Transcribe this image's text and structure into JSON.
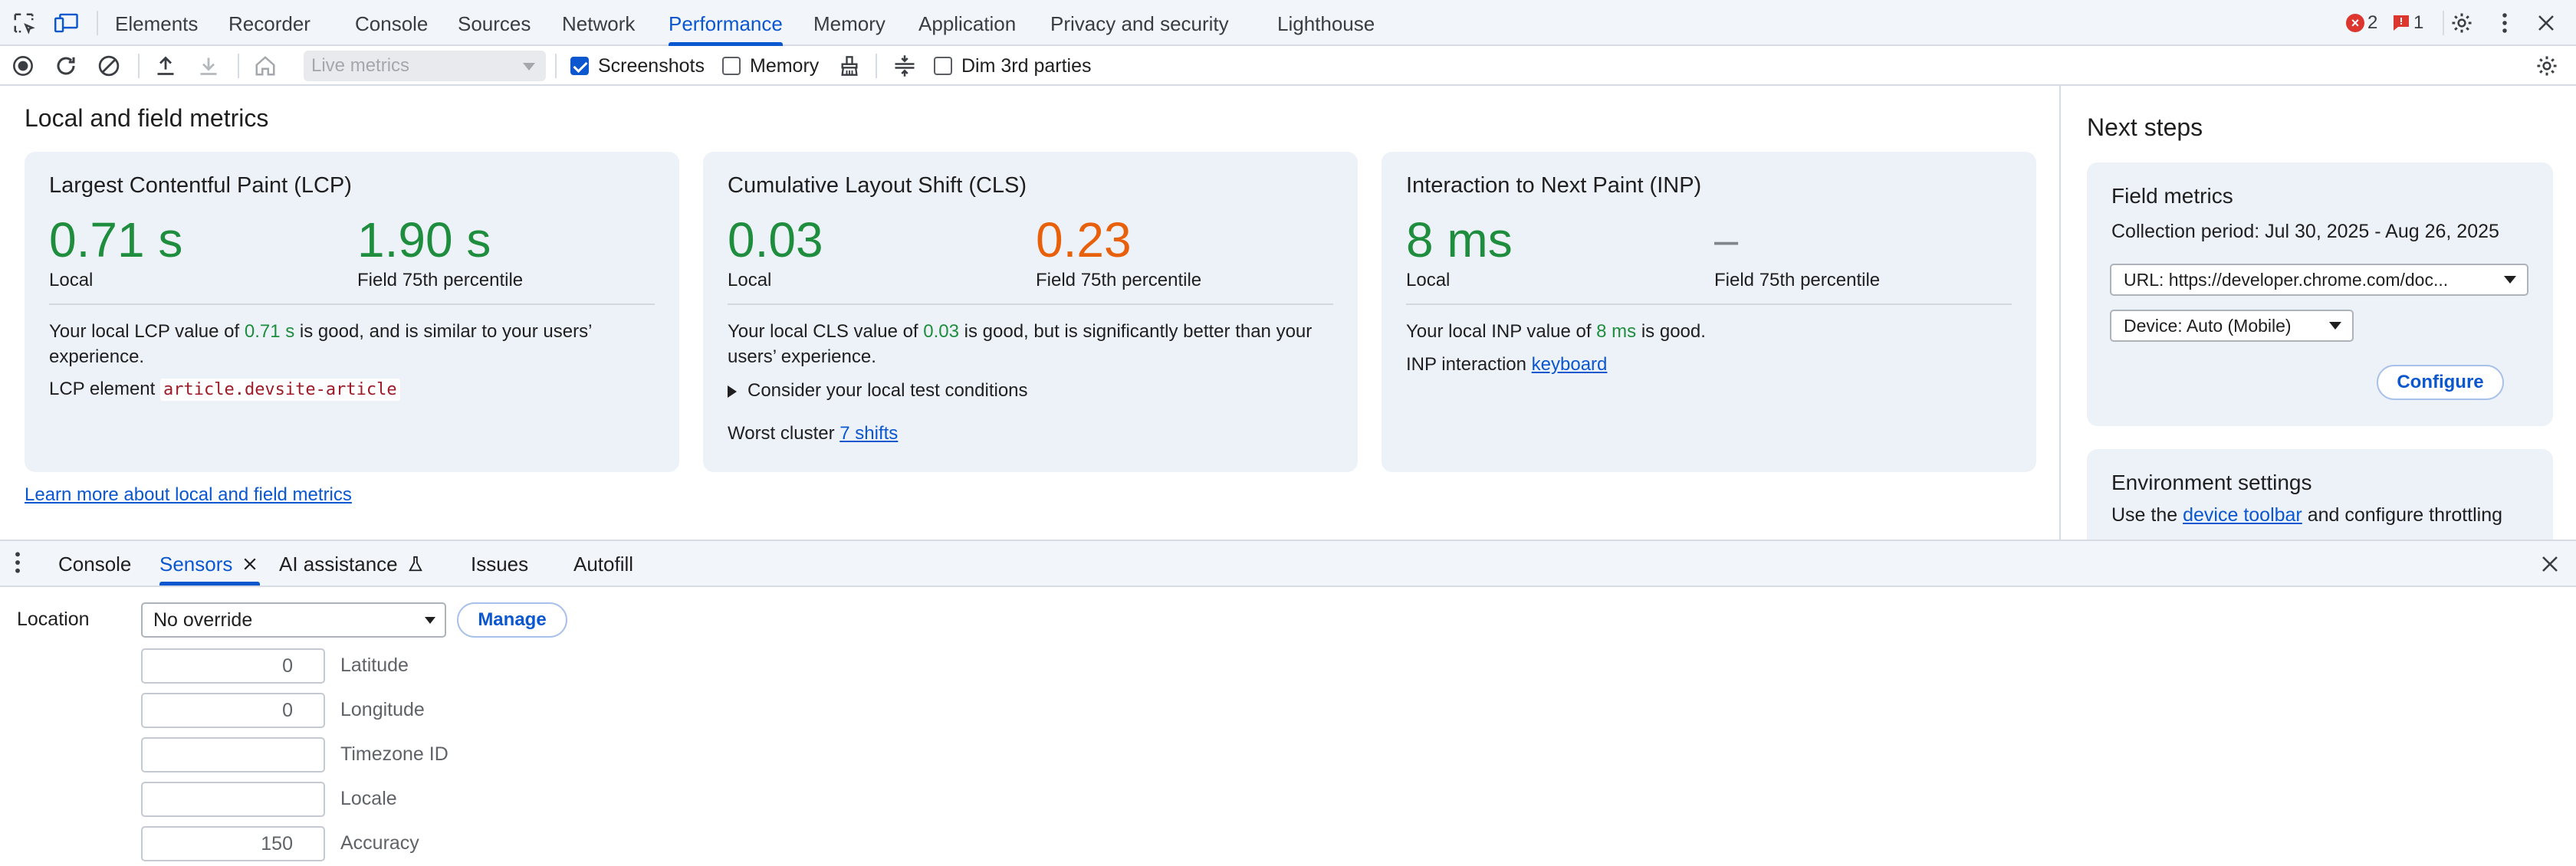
{
  "topbar": {
    "tabs": [
      "Elements",
      "Recorder",
      "Console",
      "Sources",
      "Network",
      "Performance",
      "Memory",
      "Application",
      "Privacy and security",
      "Lighthouse"
    ],
    "active_tab": "Performance",
    "error_count": "2",
    "issue_count": "1",
    "icons": [
      "inspect-element-icon",
      "device-toolbar-icon",
      "error-icon",
      "issue-flag-icon",
      "settings-gear-icon",
      "more-vertical-icon",
      "close-icon"
    ]
  },
  "toolbar": {
    "mode_select": "Live metrics",
    "screenshots_label": "Screenshots",
    "screenshots_checked": true,
    "memory_label": "Memory",
    "memory_checked": false,
    "dim_label": "Dim 3rd parties",
    "dim_checked": false,
    "icons": [
      "record-icon",
      "reload-icon",
      "clear-icon",
      "upload-icon",
      "download-icon",
      "home-icon",
      "broom-icon",
      "split-icon",
      "settings-gear-icon"
    ]
  },
  "main": {
    "title": "Local and field metrics",
    "learn_more": "Learn more about local and field metrics",
    "lcp": {
      "title": "Largest Contentful Paint (LCP)",
      "local_value": "0.71 s",
      "local_label": "Local",
      "field_value": "1.90 s",
      "field_label": "Field 75th percentile",
      "text_before": "Your local LCP value of ",
      "text_value": "0.71 s",
      "text_after": " is good, and is similar to your users’ experience.",
      "element_label": "LCP element",
      "element_code": "article.devsite-article"
    },
    "cls": {
      "title": "Cumulative Layout Shift (CLS)",
      "local_value": "0.03",
      "local_label": "Local",
      "field_value": "0.23",
      "field_label": "Field 75th percentile",
      "text_before": "Your local CLS value of ",
      "text_value": "0.03",
      "text_after": " is good, but is significantly better than your users’ experience.",
      "consider": "Consider your local test conditions",
      "worst_label": "Worst cluster",
      "worst_link": "7 shifts"
    },
    "inp": {
      "title": "Interaction to Next Paint (INP)",
      "local_value": "8 ms",
      "local_label": "Local",
      "field_value": "–",
      "field_label": "Field 75th percentile",
      "text_before": "Your local INP value of ",
      "text_value": "8 ms",
      "text_after": " is good.",
      "interaction_label": "INP interaction",
      "interaction_link": "keyboard"
    }
  },
  "right_panel": {
    "title": "Next steps",
    "field_title": "Field metrics",
    "collection_period": "Collection period: Jul 30, 2025 - Aug 26, 2025",
    "url_select": "URL: https://developer.chrome.com/doc...",
    "device_select": "Device: Auto (Mobile)",
    "configure": "Configure",
    "env_title": "Environment settings",
    "env_text_before": "Use the ",
    "env_link": "device toolbar",
    "env_text_after": " and configure throttling"
  },
  "drawer": {
    "tabs": [
      "Console",
      "Sensors",
      "AI assistance",
      "Issues",
      "Autofill"
    ],
    "active_tab": "Sensors",
    "location_label": "Location",
    "location_select": "No override",
    "manage": "Manage",
    "fields": [
      {
        "value": "0",
        "label": "Latitude"
      },
      {
        "value": "0",
        "label": "Longitude"
      },
      {
        "value": "",
        "label": "Timezone ID"
      },
      {
        "value": "",
        "label": "Locale"
      },
      {
        "value": "150",
        "label": "Accuracy"
      }
    ]
  },
  "colors": {
    "accent": "#0b57d0",
    "good": "#1e8e3e",
    "needs_improvement": "#e8610a",
    "card_bg": "#edf1f8",
    "error_red": "#dc362e"
  }
}
